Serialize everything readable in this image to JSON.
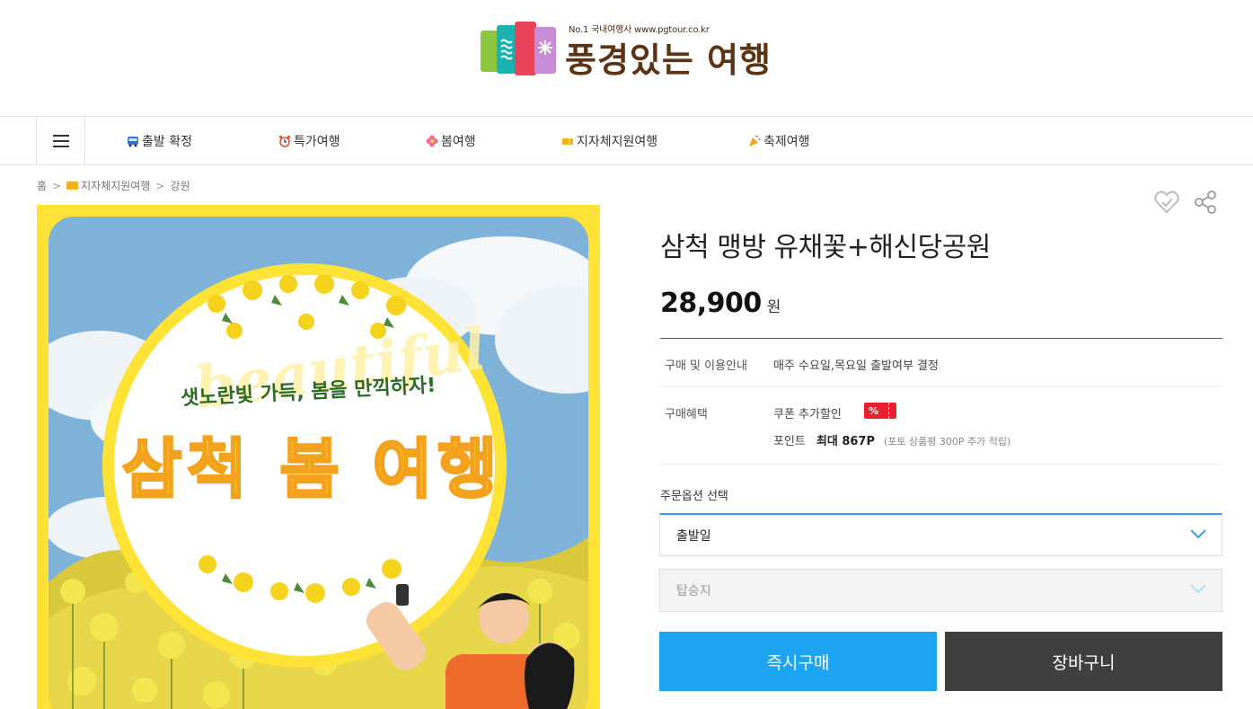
{
  "header": {
    "logo_slogan": "No.1 국내여행사 www.pgtour.co.kr",
    "logo_name": "풍경있는 여행"
  },
  "nav": {
    "menu_icon": "hamburger-icon",
    "items": [
      {
        "label": "출발 확정",
        "icon": "bus-icon"
      },
      {
        "label": "특가여행",
        "icon": "alarm-clock-icon"
      },
      {
        "label": "봄여행",
        "icon": "flower-icon"
      },
      {
        "label": "지자체지원여행",
        "icon": "ticket-icon"
      },
      {
        "label": "축제여행",
        "icon": "party-popper-icon"
      }
    ]
  },
  "breadcrumb": {
    "home": "홈",
    "category": "지자체지원여행",
    "region": "강원"
  },
  "product_image": {
    "headline": "샛노란빛 가득, 봄을 만끽하자!",
    "title": "삼척 봄 여행",
    "script_word": "beautiful"
  },
  "actions": {
    "wishlist_icon": "heart-check-icon",
    "share_icon": "share-icon"
  },
  "product": {
    "title": "삼척 맹방 유채꽃+해신당공원",
    "price": "28,900",
    "currency": "원"
  },
  "info": {
    "guide_label": "구매 및 이용안내",
    "guide_value": "매주 수요일,목요일 출발여부 결정",
    "benefit_label": "구매혜택",
    "coupon_label": "쿠폰 추가할인",
    "coupon_badge": "%",
    "point_label": "포인트",
    "point_value": "최대 867P",
    "point_note": "(포토 상품평 300P 추가 적립)"
  },
  "options": {
    "title": "주문옵션 선택",
    "departure_placeholder": "출발일",
    "boarding_placeholder": "탑승지"
  },
  "buttons": {
    "buy_now": "즉시구매",
    "cart": "장바구니"
  },
  "colors": {
    "buy_button": "#1ea5f1",
    "cart_button": "#404040",
    "coupon_badge": "#e8202f",
    "logo_brown": "#5a3414",
    "image_border": "#ffe236"
  }
}
